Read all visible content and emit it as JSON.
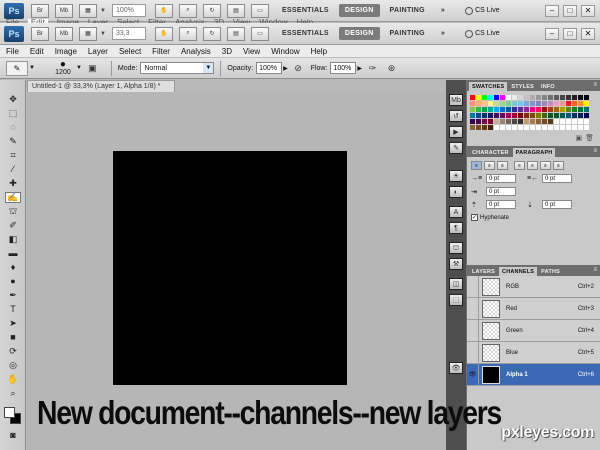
{
  "app_bar": {
    "logo": "Ps",
    "zoom": "100%",
    "zoom_second": "33,3",
    "workspaces": [
      "ESSENTIALS",
      "DESIGN",
      "PAINTING"
    ],
    "active_workspace": "DESIGN",
    "more": "»",
    "cs_live": "CS Live"
  },
  "ghost_menu": [
    "File",
    "Edit",
    "Image",
    "Layer",
    "Select",
    "Filter",
    "Analysis",
    "3D",
    "View",
    "Window",
    "Help"
  ],
  "menu": [
    "File",
    "Edit",
    "Image",
    "Layer",
    "Select",
    "Filter",
    "Analysis",
    "3D",
    "View",
    "Window",
    "Help"
  ],
  "options_bar": {
    "brush_size": "1200",
    "mode_label": "Mode:",
    "mode_value": "Normal",
    "opacity_label": "Opacity:",
    "opacity_value": "100%",
    "flow_label": "Flow:",
    "flow_value": "100%"
  },
  "document": {
    "tab_title": "Untitled-1 @ 33,3% (Layer 1, Alpha 1/8) *",
    "canvas_color": "#000000"
  },
  "swatches": {
    "tabs": [
      "SWATCHES",
      "STYLES",
      "INFO"
    ],
    "colors": [
      "#ff0000",
      "#ffff00",
      "#00ff00",
      "#00ffff",
      "#0000ff",
      "#ff00ff",
      "#ffffff",
      "#ebebeb",
      "#d6d6d6",
      "#c2c2c2",
      "#adadad",
      "#999999",
      "#858585",
      "#707070",
      "#5c5c5c",
      "#474747",
      "#333333",
      "#1f1f1f",
      "#0a0a0a",
      "#000000",
      "#f7977a",
      "#f9ad81",
      "#fdc68a",
      "#fff79a",
      "#c4df9b",
      "#a2d39c",
      "#82ca9d",
      "#7bcdc8",
      "#6ecff6",
      "#7ea7d8",
      "#8493ca",
      "#8882be",
      "#a187be",
      "#bc8dbf",
      "#f49ac2",
      "#f6989d",
      "#ed1c24",
      "#f26522",
      "#f7941d",
      "#fff200",
      "#8dc63f",
      "#39b54a",
      "#00a651",
      "#00a99d",
      "#00aeef",
      "#0072bc",
      "#0054a6",
      "#2e3192",
      "#662d91",
      "#92278f",
      "#ec008c",
      "#ed145b",
      "#9e0b0f",
      "#a0410d",
      "#a36209",
      "#aba000",
      "#598527",
      "#1a7b30",
      "#007236",
      "#00746b",
      "#0076a3",
      "#004b80",
      "#003471",
      "#1b1464",
      "#440e62",
      "#630460",
      "#9e005d",
      "#9e0039",
      "#790000",
      "#7b2e00",
      "#7d4900",
      "#827b00",
      "#406618",
      "#005e20",
      "#005826",
      "#005952",
      "#005b7f",
      "#003663",
      "#002157",
      "#0d004c",
      "#32004b",
      "#4b0049",
      "#7b0046",
      "#7a0026",
      "#c7b299",
      "#998675",
      "#736357",
      "#534741",
      "#37302d",
      "#c69c6d",
      "#a67c52",
      "#8c6239",
      "#754c24",
      "#603913",
      "#ffffff",
      "#ffffff",
      "#ffffff",
      "#ffffff",
      "#ffffff",
      "#ffffff",
      "#8c6239",
      "#754c24",
      "#603913",
      "#42210b",
      "#ffffff",
      "#ffffff",
      "#ffffff",
      "#ffffff",
      "#ffffff",
      "#ffffff",
      "#ffffff",
      "#ffffff",
      "#ffffff",
      "#ffffff",
      "#ffffff",
      "#ffffff",
      "#ffffff",
      "#ffffff",
      "#ffffff",
      "#ffffff"
    ]
  },
  "paragraph": {
    "tabs": [
      "CHARACTER",
      "PARAGRAPH"
    ],
    "indent_left": "0 pt",
    "indent_right": "0 pt",
    "indent_first": "0 pt",
    "space_before": "0 pt",
    "space_after": "0 pt",
    "hyphenate_label": "Hyphenate",
    "hyphenate_checked": "✓"
  },
  "channels": {
    "tabs": [
      "LAYERS",
      "CHANNELS",
      "PATHS"
    ],
    "items": [
      {
        "name": "RGB",
        "shortcut": "Ctrl+2",
        "eye": ""
      },
      {
        "name": "Red",
        "shortcut": "Ctrl+3",
        "eye": ""
      },
      {
        "name": "Green",
        "shortcut": "Ctrl+4",
        "eye": ""
      },
      {
        "name": "Blue",
        "shortcut": "Ctrl+5",
        "eye": ""
      },
      {
        "name": "Alpha 1",
        "shortcut": "Ctrl+6",
        "eye": "👁"
      }
    ]
  },
  "caption": "New document--channels--new layers",
  "watermark": "pxleyes.com"
}
